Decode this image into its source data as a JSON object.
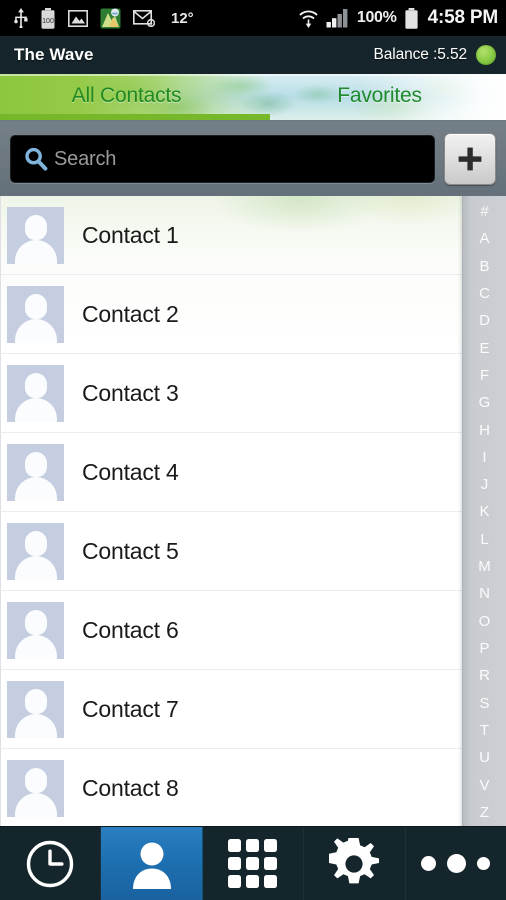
{
  "statusbar": {
    "icons": [
      "usb-icon",
      "battery-100-icon",
      "image-icon",
      "maps-icon",
      "email-icon"
    ],
    "temperature": "12°",
    "right_icons": [
      "wifi-icon",
      "cellular-signal-icon"
    ],
    "battery_percent": "100%",
    "battery_icon": "battery-full-icon",
    "clock": "4:58 PM"
  },
  "titlebar": {
    "app_title": "The Wave",
    "balance_label": "Balance :5.52",
    "balance_status_icon": "green-status-dot",
    "balance_status_color": "#8ecf4a",
    "background_color": "#16252b"
  },
  "tabs": {
    "items": [
      {
        "label": "All Contacts",
        "active": true
      },
      {
        "label": "Favorites",
        "active": false
      }
    ],
    "active_color": "#8cc63f",
    "active_text_color": "#1f8a1f",
    "underline_color": "#76b82a"
  },
  "search": {
    "placeholder": "Search",
    "value": "",
    "icon": "search-icon",
    "add_button_label": "+",
    "add_button_icon": "plus-icon",
    "bar_background": "#6d787f"
  },
  "contacts": {
    "rows": [
      {
        "name": "Contact 1",
        "avatar": "person-placeholder-avatar"
      },
      {
        "name": "Contact 2",
        "avatar": "person-placeholder-avatar"
      },
      {
        "name": "Contact 3",
        "avatar": "person-placeholder-avatar"
      },
      {
        "name": "Contact 4",
        "avatar": "person-placeholder-avatar"
      },
      {
        "name": "Contact 5",
        "avatar": "person-placeholder-avatar"
      },
      {
        "name": "Contact 6",
        "avatar": "person-placeholder-avatar"
      },
      {
        "name": "Contact 7",
        "avatar": "person-placeholder-avatar"
      },
      {
        "name": "Contact 8",
        "avatar": "person-placeholder-avatar"
      }
    ]
  },
  "alpha_index": {
    "letters": [
      "#",
      "A",
      "B",
      "C",
      "D",
      "E",
      "F",
      "G",
      "H",
      "I",
      "J",
      "K",
      "L",
      "M",
      "N",
      "O",
      "P",
      "R",
      "S",
      "T",
      "U",
      "V",
      "Z"
    ],
    "background_color": "#ccd0d4",
    "text_color": "#fbfbfb"
  },
  "bottomnav": {
    "items": [
      {
        "icon": "clock-icon",
        "active": false
      },
      {
        "icon": "person-icon",
        "active": true
      },
      {
        "icon": "dialpad-grid-icon",
        "active": false
      },
      {
        "icon": "gear-icon",
        "active": false
      },
      {
        "icon": "more-dots-icon",
        "active": false
      }
    ],
    "active_color": "#1c6fb0",
    "background_color": "#15252c"
  }
}
